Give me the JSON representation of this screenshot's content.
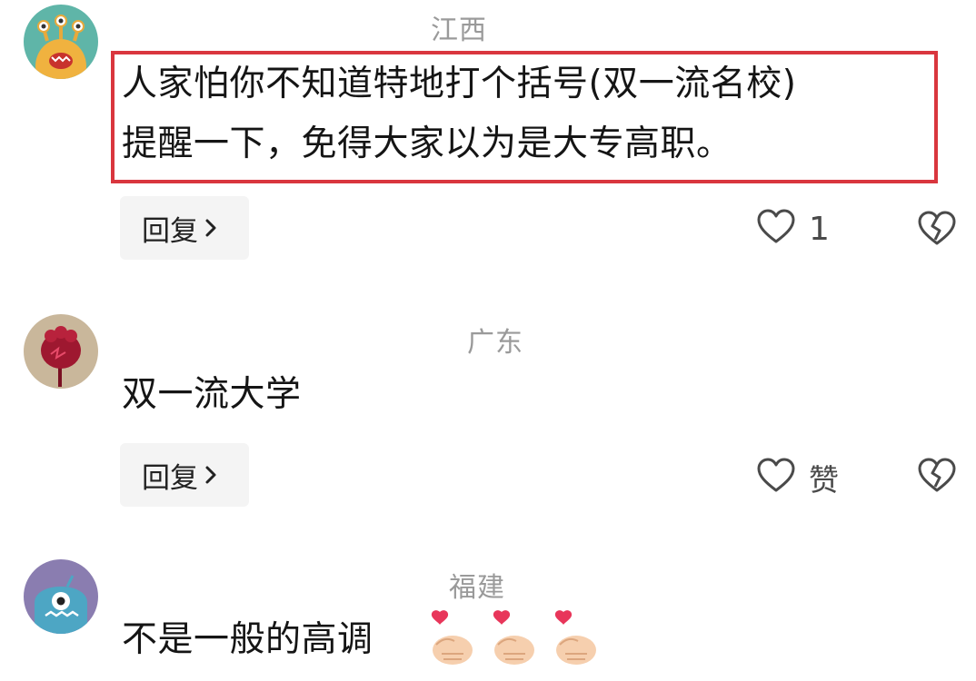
{
  "comments": [
    {
      "location": "江西",
      "lines": [
        "人家怕你不知道特地打个括号(双一流名校)",
        "提醒一下，免得大家以为是大专高职。"
      ],
      "reply_label": "回复",
      "like_label": "1",
      "highlighted": true,
      "avatar_color": "#5fb5a8"
    },
    {
      "location": "广东",
      "lines": [
        "双一流大学"
      ],
      "reply_label": "回复",
      "like_label": "赞",
      "avatar_color": "#c9b79b"
    },
    {
      "location": "福建",
      "lines": [
        "不是一般的高调"
      ],
      "emoji_count": 3,
      "avatar_color": "#8a7db0"
    }
  ],
  "colors": {
    "highlight": "#d9363e",
    "meta_text": "#9a9a9a",
    "reply_bg": "#f4f4f4"
  },
  "icons": [
    "heart-outline-icon",
    "broken-heart-icon",
    "chevron-right-icon",
    "finger-heart-emoji"
  ]
}
